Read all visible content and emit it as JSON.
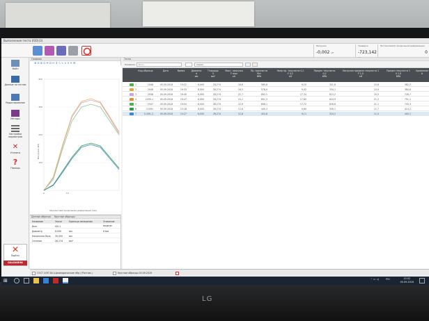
{
  "window": {
    "title": "Выполнение теста (ISO)(3)"
  },
  "readouts": [
    {
      "label": "Нагрузка",
      "value": "-0,002",
      "unit": "кН"
    },
    {
      "label": "Траверса",
      "value": "-723,142",
      "unit": "мм"
    },
    {
      "label": "Экстензометр продольной деформации",
      "value": "0",
      "unit": ""
    }
  ],
  "sidebar": {
    "items": [
      {
        "label": "Файл",
        "icon": "folder-icon"
      },
      {
        "label": "Данные по тестам",
        "icon": "grid-icon"
      },
      {
        "label": "Редактирование",
        "icon": "edit-icon"
      },
      {
        "label": "Методы",
        "icon": "book-icon"
      },
      {
        "label": "Настройки параметров",
        "icon": "sliders-icon"
      },
      {
        "label": "Утилиты",
        "icon": "tools-icon"
      },
      {
        "label": "Помощь",
        "icon": "help-icon"
      }
    ],
    "exit_label": "Выйти",
    "brand": "GALDABINI"
  },
  "chart_panel": {
    "header": "Графики",
    "xlabel": "Абсолютная продольная деформация (мм)",
    "ylabel": "Нагрузка (кН)"
  },
  "chart_data": {
    "type": "line",
    "xlabel": "Абсолютная продольная деформация (мм)",
    "ylabel": "Нагрузка (кН)",
    "y_ticks": [
      "400",
      "300",
      "200",
      "100"
    ],
    "x_ticks": [
      "0",
      "10"
    ],
    "series": [
      {
        "color": "#8bc48b",
        "points": [
          [
            0,
            0
          ],
          [
            4,
            40
          ],
          [
            8,
            150
          ],
          [
            12,
            250
          ],
          [
            16,
            300
          ],
          [
            20,
            310
          ],
          [
            24,
            300
          ],
          [
            28,
            250
          ],
          [
            32,
            200
          ]
        ]
      },
      {
        "color": "#d4a5cf",
        "points": [
          [
            0,
            0
          ],
          [
            4,
            45
          ],
          [
            8,
            160
          ],
          [
            12,
            265
          ],
          [
            16,
            315
          ],
          [
            20,
            325
          ],
          [
            24,
            315
          ],
          [
            28,
            260
          ],
          [
            32,
            205
          ]
        ]
      },
      {
        "color": "#e4b45a",
        "points": [
          [
            0,
            0
          ],
          [
            4,
            48
          ],
          [
            8,
            165
          ],
          [
            12,
            270
          ],
          [
            16,
            320
          ],
          [
            20,
            330
          ],
          [
            24,
            318
          ],
          [
            28,
            265
          ],
          [
            32,
            210
          ]
        ]
      },
      {
        "color": "#2e9b46",
        "points": [
          [
            0,
            0
          ],
          [
            4,
            20
          ],
          [
            8,
            70
          ],
          [
            12,
            120
          ],
          [
            16,
            160
          ],
          [
            20,
            170
          ],
          [
            24,
            160
          ],
          [
            28,
            120
          ],
          [
            32,
            80
          ]
        ]
      },
      {
        "color": "#3f86c5",
        "points": [
          [
            0,
            0
          ],
          [
            4,
            18
          ],
          [
            8,
            65
          ],
          [
            12,
            115
          ],
          [
            16,
            155
          ],
          [
            20,
            165
          ],
          [
            24,
            155
          ],
          [
            28,
            115
          ],
          [
            32,
            75
          ]
        ]
      }
    ]
  },
  "specimen_panel": {
    "header": "Данные образца",
    "subheader": "Круглые образцы",
    "col_labels": [
      "Название",
      "Значе",
      "Единица измерения",
      "Описание модели"
    ],
    "rows": [
      {
        "name": "Имя",
        "value": "ISV-1",
        "unit": "",
        "desc": ""
      },
      {
        "name": "Диаметр",
        "value": "6,000",
        "unit": "мм",
        "desc": "6 мм"
      },
      {
        "name": "Начальная база",
        "value": "30,000",
        "unit": "мм",
        "desc": ""
      },
      {
        "name": "Сечение",
        "value": "28,274",
        "unit": "мм²",
        "desc": ""
      }
    ]
  },
  "table_panel": {
    "header": "Тесты",
    "filter_label": "Название",
    "filter_placeholder": "Блок",
    "series_label": "Серия",
    "columns": [
      "Код образца",
      "Дата",
      "Время",
      "Диаметр\nd\nмм",
      "Площадь\nS\nмм²",
      "Макс. нагрузка\nF max\nкН",
      "Пр. прочности\nRm\nMPa",
      "Напр пр. текучести 0,2\nF 0,2\nкН",
      "Предел текучести\n0,2\nMPa",
      "Нагрузка предела текучести 1\nF 1,0\nкН",
      "Предел текучести 1\n0 1,0\nMPa",
      "Удлинение\nA"
    ],
    "rows": [
      {
        "n": "1",
        "color": "#4fb04f",
        "code": "1048",
        "date": "05.09.2018",
        "time": "19:22",
        "d": "6,000",
        "s": "28,274",
        "fmax": "16,6",
        "rm": "585,8",
        "f02": "9,10",
        "r02": "321,8",
        "f1": "10,8",
        "r1": "382,3",
        "a": ""
      },
      {
        "n": "2",
        "color": "#e0a83a",
        "code": "2048",
        "date": "05.09.2018",
        "time": "19:33",
        "d": "6,000",
        "s": "28,274",
        "fmax": "16,5",
        "rm": "578,9",
        "f02": "9,42",
        "r02": "334,1",
        "f1": "10,9",
        "r1": "384,6",
        "a": ""
      },
      {
        "n": "3",
        "color": "#c9a4d4",
        "code": "2048",
        "date": "05.09.2018",
        "time": "19:40",
        "d": "6,000",
        "s": "28,274",
        "fmax": "22,7",
        "rm": "802,1",
        "f02": "17,34",
        "r02": "613,2",
        "f1": "20,5",
        "r1": "726,7",
        "a": ""
      },
      {
        "n": "4",
        "color": "#e58b3a",
        "code": "2209-1",
        "date": "05.09.2018",
        "time": "19:47",
        "d": "6,000",
        "s": "28,274",
        "fmax": "24,1",
        "rm": "851,3",
        "f02": "17,60",
        "r02": "624,9",
        "f1": "21,2",
        "r1": "751,1",
        "a": ""
      },
      {
        "n": "5",
        "color": "#4fb04f",
        "code": "2347",
        "date": "05.09.2018",
        "time": "19:54",
        "d": "6,000",
        "s": "28,274",
        "fmax": "22,9",
        "rm": "808,1",
        "f02": "17,72",
        "r02": "626,6",
        "f1": "21,1",
        "r1": "745,3",
        "a": ""
      },
      {
        "n": "6",
        "color": "#2e9b46",
        "code": "11091",
        "date": "05.09.2018",
        "time": "13:18",
        "d": "6,000",
        "s": "28,274",
        "fmax": "12,6",
        "rm": "445,3",
        "f02": "9,60",
        "r02": "339,1",
        "f1": "11,7",
        "r1": "414,2",
        "a": ""
      },
      {
        "n": "7",
        "color": "#3f86c5",
        "code": "11091-2",
        "date": "05.09.2018",
        "time": "13:27",
        "d": "6,000",
        "s": "28,274",
        "fmax": "12,8",
        "rm": "452,8",
        "f02": "9,11",
        "r02": "324,1",
        "f1": "11,0",
        "r1": "400,1",
        "a": ""
      }
    ]
  },
  "doc_tabs": [
    {
      "label": "ГОСТ 1497-84 (Цилиндрические обр.) (Растяж.)"
    },
    {
      "label": "Круглые образцы 05.09.2018"
    }
  ],
  "taskbar": {
    "lang": "РУС",
    "time": "15:52",
    "date": "05.09.2018"
  },
  "monitor": {
    "logo": "LG"
  }
}
